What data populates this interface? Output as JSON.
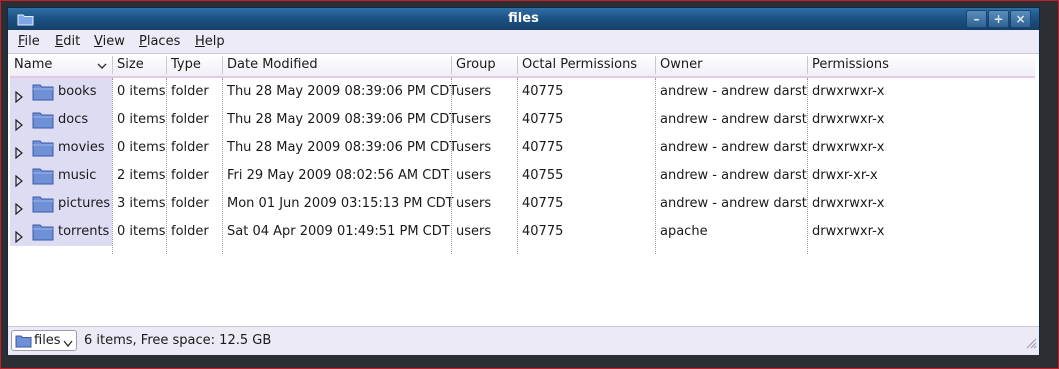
{
  "window": {
    "title": "files",
    "controls": {
      "minimize": "–",
      "maximize": "+",
      "close": "×"
    }
  },
  "menubar": {
    "items": [
      {
        "mnemonic": "F",
        "rest": "ile"
      },
      {
        "mnemonic": "E",
        "rest": "dit"
      },
      {
        "mnemonic": "V",
        "rest": "iew"
      },
      {
        "mnemonic": "P",
        "rest": "laces"
      },
      {
        "mnemonic": "H",
        "rest": "elp"
      }
    ]
  },
  "columns": [
    "Name",
    "Size",
    "Type",
    "Date Modified",
    "Group",
    "Octal Permissions",
    "Owner",
    "Permissions"
  ],
  "rows": [
    {
      "name": "books",
      "size": "0 items",
      "type": "folder",
      "modified": "Thu 28 May 2009 08:39:06 PM CDT",
      "group": "users",
      "octal": "40775",
      "owner": "andrew - andrew darst",
      "perms": "drwxrwxr-x"
    },
    {
      "name": "docs",
      "size": "0 items",
      "type": "folder",
      "modified": "Thu 28 May 2009 08:39:06 PM CDT",
      "group": "users",
      "octal": "40775",
      "owner": "andrew - andrew darst",
      "perms": "drwxrwxr-x"
    },
    {
      "name": "movies",
      "size": "0 items",
      "type": "folder",
      "modified": "Thu 28 May 2009 08:39:06 PM CDT",
      "group": "users",
      "octal": "40775",
      "owner": "andrew - andrew darst",
      "perms": "drwxrwxr-x"
    },
    {
      "name": "music",
      "size": "2 items",
      "type": "folder",
      "modified": "Fri 29 May 2009 08:02:56 AM CDT",
      "group": "users",
      "octal": "40755",
      "owner": "andrew - andrew darst",
      "perms": "drwxr-xr-x"
    },
    {
      "name": "pictures",
      "size": "3 items",
      "type": "folder",
      "modified": "Mon 01 Jun 2009 03:15:13 PM CDT",
      "group": "users",
      "octal": "40775",
      "owner": "andrew - andrew darst",
      "perms": "drwxrwxr-x"
    },
    {
      "name": "torrents",
      "size": "0 items",
      "type": "folder",
      "modified": "Sat 04 Apr 2009 01:49:51 PM CDT",
      "group": "users",
      "octal": "40775",
      "owner": "apache",
      "perms": "drwxrwxr-x"
    }
  ],
  "statusbar": {
    "path_button": "files",
    "status": "6 items, Free space: 12.5 GB"
  },
  "colors": {
    "titlebar": "#1d5385",
    "selection": "#dedcf3",
    "folder": "#6f8fd6"
  },
  "icons": {
    "app": "folder-icon",
    "expander": "triangle-right-icon",
    "sort": "chevron-down-icon",
    "grip": "resize-grip-icon"
  }
}
